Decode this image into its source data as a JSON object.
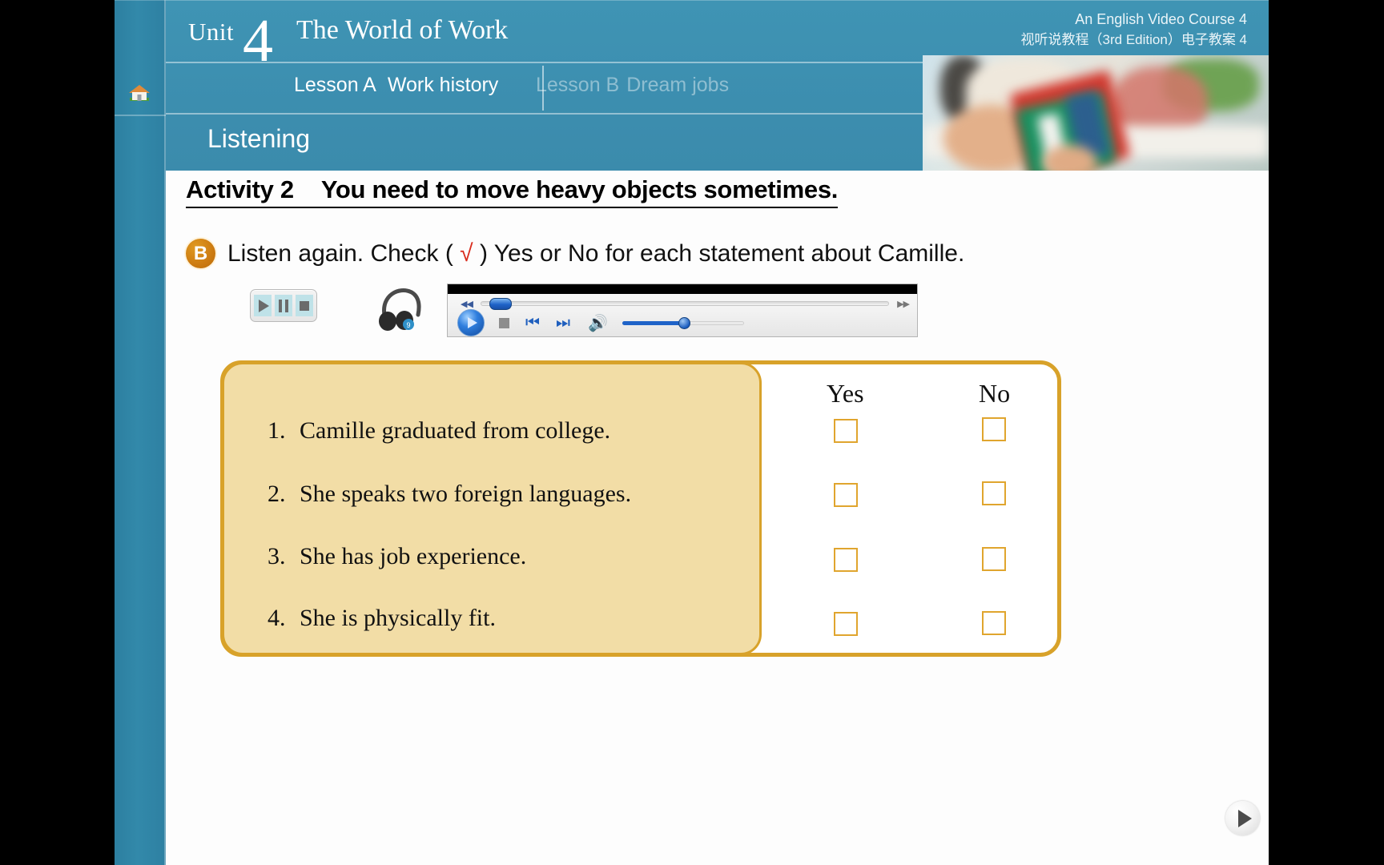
{
  "header": {
    "unit_label": "Unit",
    "unit_number": "4",
    "unit_title": "The World of Work",
    "lesson_a": "Lesson A",
    "lesson_a_title": "Work history",
    "lesson_b": "Lesson B",
    "lesson_b_title": "Dream jobs",
    "section_title": "Listening",
    "course_line1": "An English Video Course 4",
    "course_line2": "视听说教程（3rd Edition）电子教案 4"
  },
  "sidebar": {
    "home_icon": "home-icon"
  },
  "main": {
    "activity_label": "Activity 2",
    "activity_title": "You need to move heavy objects sometimes.",
    "task_badge": "B",
    "task_text_before": "Listen again. Check ( ",
    "task_check": "√",
    "task_text_after": " ) Yes or No for each statement about Camille.",
    "columns": [
      "Yes",
      "No"
    ],
    "questions": [
      {
        "num": "1.",
        "text": "Camille graduated from college."
      },
      {
        "num": "2.",
        "text": "She speaks two foreign languages."
      },
      {
        "num": "3.",
        "text": "She has job experience."
      },
      {
        "num": "4.",
        "text": "She is physically fit."
      }
    ]
  },
  "media": {
    "play_icon": "play-icon",
    "pause_icon": "pause-icon",
    "stop_icon": "stop-icon",
    "headphones_icon": "headphones-icon",
    "rewind_icon": "rewind-icon",
    "fastforward_icon": "fast-forward-icon",
    "previous_icon": "previous-track-icon",
    "next_icon": "next-track-icon",
    "volume_icon": "volume-icon",
    "seek_percent": 8,
    "volume_percent": 50
  },
  "footer": {
    "next_slide_icon": "play-icon"
  },
  "colors": {
    "header_blue": "#3c8dae",
    "rail_blue": "#3289aa",
    "badge_orange": "#cc7a10",
    "panel_yellow": "#f2dda6",
    "panel_border": "#d8a22a",
    "checkbox_border": "#e0a52e",
    "check_red": "#d92b1c"
  }
}
